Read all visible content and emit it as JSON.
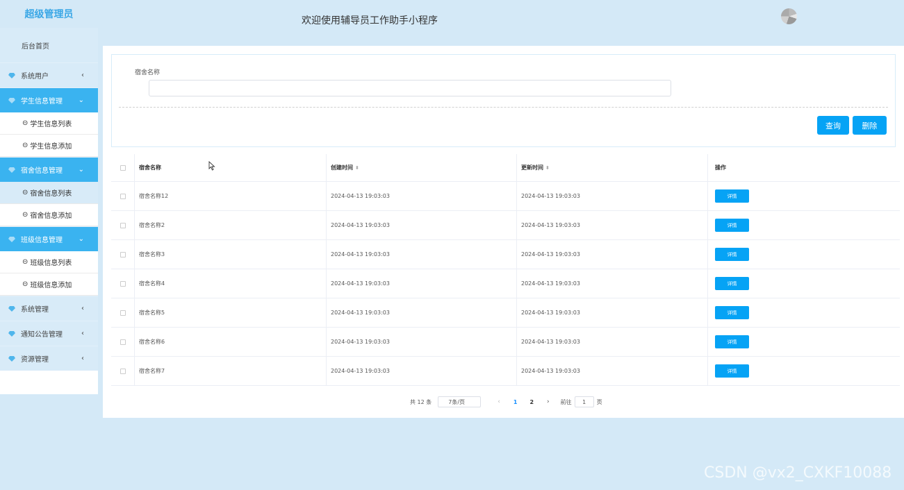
{
  "brand": "超级管理员",
  "header": {
    "title": "欢迎使用辅导员工作助手小程序"
  },
  "sidebar": {
    "home": "后台首页",
    "groups": [
      {
        "label": "系统用户",
        "open": false,
        "items": []
      },
      {
        "label": "学生信息管理",
        "open": true,
        "items": [
          "学生信息列表",
          "学生信息添加"
        ]
      },
      {
        "label": "宿舍信息管理",
        "open": true,
        "items": [
          "宿舍信息列表",
          "宿舍信息添加"
        ]
      },
      {
        "label": "班级信息管理",
        "open": true,
        "items": [
          "班级信息列表",
          "班级信息添加"
        ]
      },
      {
        "label": "系统管理",
        "open": false,
        "items": []
      },
      {
        "label": "通知公告管理",
        "open": false,
        "items": []
      },
      {
        "label": "资源管理",
        "open": false,
        "items": []
      }
    ],
    "active_item": "宿舍信息列表"
  },
  "search": {
    "label": "宿舍名称",
    "value": "",
    "query_label": "查询",
    "delete_label": "删除"
  },
  "table": {
    "columns": [
      "宿舍名称",
      "创建时间",
      "更新时间",
      "操作"
    ],
    "rows": [
      {
        "name": "宿舍名称12",
        "created": "2024-04-13 19:03:03",
        "updated": "2024-04-13 19:03:03"
      },
      {
        "name": "宿舍名称2",
        "created": "2024-04-13 19:03:03",
        "updated": "2024-04-13 19:03:03"
      },
      {
        "name": "宿舍名称3",
        "created": "2024-04-13 19:03:03",
        "updated": "2024-04-13 19:03:03"
      },
      {
        "name": "宿舍名称4",
        "created": "2024-04-13 19:03:03",
        "updated": "2024-04-13 19:03:03"
      },
      {
        "name": "宿舍名称5",
        "created": "2024-04-13 19:03:03",
        "updated": "2024-04-13 19:03:03"
      },
      {
        "name": "宿舍名称6",
        "created": "2024-04-13 19:03:03",
        "updated": "2024-04-13 19:03:03"
      },
      {
        "name": "宿舍名称7",
        "created": "2024-04-13 19:03:03",
        "updated": "2024-04-13 19:03:03"
      }
    ],
    "detail_label": "详情"
  },
  "pagination": {
    "total": "共 12 条",
    "page_size": "7条/页",
    "pages": [
      "1",
      "2"
    ],
    "current": "1",
    "goto_prefix": "前往",
    "goto_value": "1",
    "goto_suffix": "页"
  },
  "watermark": "CSDN @vx2_CXKF10088",
  "colors": {
    "accent": "#06a3f5",
    "sidebar_active": "#3ab3f0",
    "background": "#d4e9f7"
  }
}
